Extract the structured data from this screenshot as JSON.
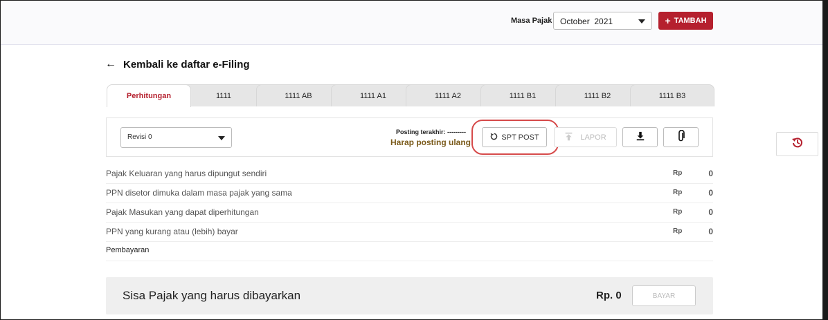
{
  "header": {
    "masa_pajak_label": "Masa Pajak",
    "period_value": "October  2021",
    "tambah_label": "TAMBAH"
  },
  "back_label": "Kembali ke daftar e-Filing",
  "tabs": [
    {
      "label": "Perhitungan",
      "active": true
    },
    {
      "label": "1111"
    },
    {
      "label": "1111 AB"
    },
    {
      "label": "1111 A1"
    },
    {
      "label": "1111 A2"
    },
    {
      "label": "1111 B1"
    },
    {
      "label": "1111 B2"
    },
    {
      "label": "1111 B3"
    }
  ],
  "toolbar": {
    "revisi_value": "Revisi 0",
    "posting_label": "Posting terakhir: ---------",
    "posting_warning": "Harap posting ulang!",
    "spt_post_label": "SPT POST",
    "lapor_label": "LAPOR"
  },
  "rows": [
    {
      "label": "Pajak Keluaran yang harus dipungut sendiri",
      "currency": "Rp",
      "value": "0"
    },
    {
      "label": "PPN disetor dimuka dalam masa pajak yang sama",
      "currency": "Rp",
      "value": "0"
    },
    {
      "label": "Pajak Masukan yang dapat diperhitungan",
      "currency": "Rp",
      "value": "0"
    },
    {
      "label": "PPN yang kurang atau (lebih) bayar",
      "currency": "Rp",
      "value": "0"
    }
  ],
  "pembayaran_label": "Pembayaran",
  "sisa": {
    "label": "Sisa Pajak yang harus dibayarkan",
    "amount": "Rp. 0",
    "bayar_label": "BAYAR"
  },
  "colors": {
    "accent": "#b5202e",
    "warning_text": "#7a5a1a",
    "highlight_ring": "#d64a4a"
  },
  "icons": {
    "back": "arrow-left-icon",
    "tambah": "plus-icon",
    "spt_post": "refresh-icon",
    "lapor": "upload-icon",
    "download": "download-icon",
    "attach": "paperclip-icon",
    "history": "history-icon"
  }
}
